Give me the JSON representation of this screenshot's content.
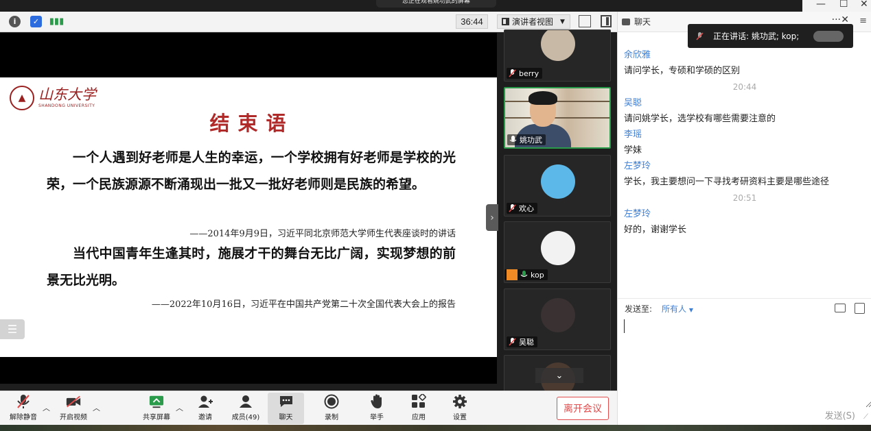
{
  "share_banner": "您正在观看姚功武的屏幕",
  "timer": "36:44",
  "view_mode": "演讲者视图",
  "slide": {
    "logo_text": "山东大学",
    "logo_sub": "SHANDONG UNIVERSITY",
    "title": "结束语",
    "para1": "一个人遇到好老师是人生的幸运，一个学校拥有好老师是学校的光荣，一个民族源源不断涌现出一批又一批好老师则是民族的希望。",
    "cite1": "——2014年9月9日，习近平同北京师范大学师生代表座谈时的讲话",
    "para2": "当代中国青年生逢其时，施展才干的舞台无比广阔，实现梦想的前景无比光明。",
    "cite2": "——2022年10月16日，习近平在中国共产党第二十次全国代表大会上的报告"
  },
  "participants": [
    {
      "name": "berry",
      "muted": true
    },
    {
      "name": "姚功武",
      "muted": false
    },
    {
      "name": "欢心",
      "muted": true
    },
    {
      "name": "kop",
      "muted": false
    },
    {
      "name": "吴聪",
      "muted": true
    }
  ],
  "toolbar": {
    "mute": "解除静音",
    "video": "开启视频",
    "share": "共享屏幕",
    "invite": "邀请",
    "members": "成员(49)",
    "chat": "聊天",
    "record": "录制",
    "raise_hand": "举手",
    "apps": "应用",
    "settings": "设置",
    "leave": "离开会议"
  },
  "chat": {
    "title": "聊天",
    "speaking": "正在讲话: 姚功武; kop;",
    "messages": [
      {
        "type": "sender",
        "text": "余欣雅"
      },
      {
        "type": "text",
        "text": "请问学长，专硕和学硕的区别"
      },
      {
        "type": "time",
        "text": "20:44"
      },
      {
        "type": "sender",
        "text": "吴聪"
      },
      {
        "type": "text",
        "text": "请问姚学长，选学校有哪些需要注意的"
      },
      {
        "type": "sender",
        "text": "李瑶"
      },
      {
        "type": "text",
        "text": "学妹"
      },
      {
        "type": "sender",
        "text": "左梦玲"
      },
      {
        "type": "text",
        "text": "学长，我主要想问一下寻找考研资料主要是哪些途径"
      },
      {
        "type": "time",
        "text": "20:51"
      },
      {
        "type": "sender",
        "text": "左梦玲"
      },
      {
        "type": "text",
        "text": "好的，谢谢学长"
      }
    ],
    "send_to_label": "发送至:",
    "send_to_value": "所有人",
    "send_button": "发送(S)"
  },
  "colors": {
    "accent": "#3e7fd6",
    "leave": "#e24b4b",
    "slide_title": "#b02a2a",
    "active_speaker": "#2a9b4a"
  }
}
